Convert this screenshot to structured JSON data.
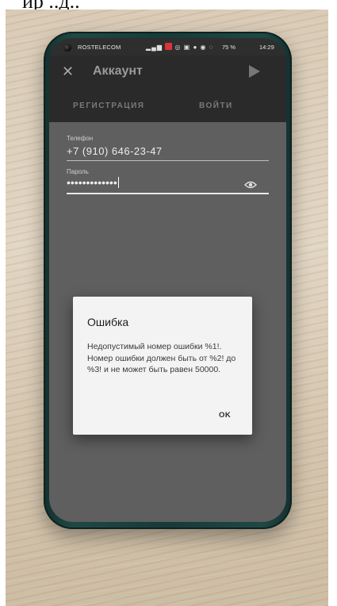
{
  "top_strip_text": "ир ..д..",
  "status_bar": {
    "operator": "ROSTELECOM",
    "battery": "75 %",
    "time": "14:29"
  },
  "app_bar": {
    "close_glyph": "✕",
    "title": "Аккаунт"
  },
  "tabs": {
    "register": "РЕГИСТРАЦИЯ",
    "login": "ВОЙТИ"
  },
  "form": {
    "phone_label": "Телефон",
    "phone_value": "+7 (910) 646-23-47",
    "password_label": "Пароль",
    "password_value": "•••••••••••••"
  },
  "dialog": {
    "title": "Ошибка",
    "message": "Недопустимый номер ошибки %1!. Номер ошибки должен быть от %2! до %3! и не может быть равен 50000.",
    "ok": "OK"
  },
  "icons": {
    "close": "close-icon",
    "send": "send-icon",
    "eye": "eye-icon"
  },
  "colors": {
    "phone_case": "#1f4845",
    "dialog_bg": "#f3f3f3",
    "overlay": "#5f5f5f",
    "status_red_badge": "#d8343a"
  }
}
